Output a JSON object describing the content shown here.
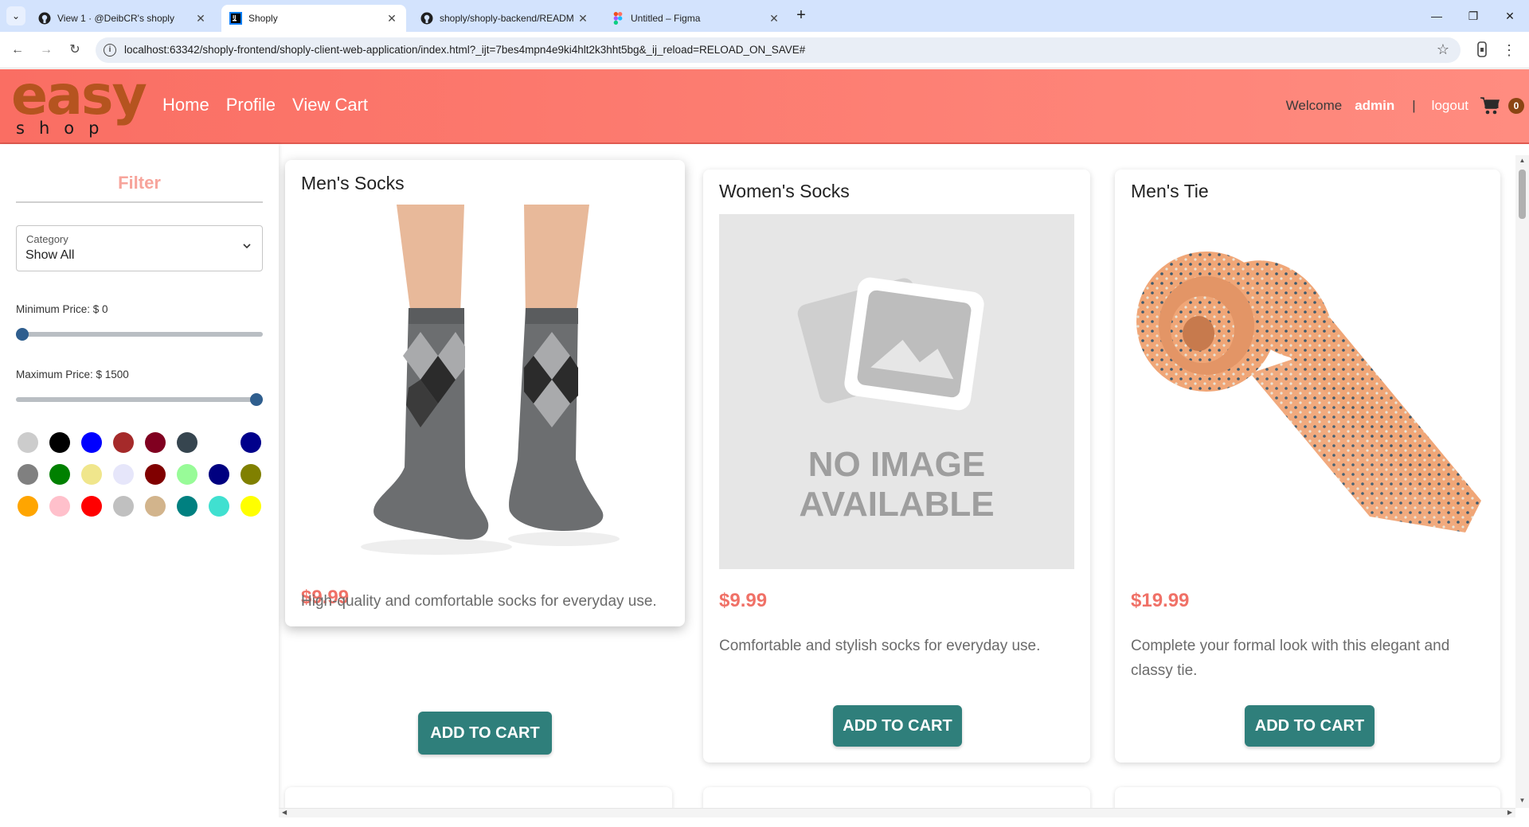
{
  "browser": {
    "tabs": [
      {
        "title": "View 1 · @DeibCR's shoply",
        "icon": "github-icon",
        "active": false
      },
      {
        "title": "Shoply",
        "icon": "intellij-icon",
        "active": true
      },
      {
        "title": "shoply/shoply-backend/READM",
        "icon": "github-icon",
        "active": false
      },
      {
        "title": "Untitled – Figma",
        "icon": "figma-icon",
        "active": false
      }
    ],
    "url": "localhost:63342/shoply-frontend/shoply-client-web-application/index.html?_ijt=7bes4mpn4e9ki4hlt2k3hht5bg&_ij_reload=RELOAD_ON_SAVE#"
  },
  "header": {
    "logo_main": "easy",
    "logo_sub": "shop",
    "nav": [
      "Home",
      "Profile",
      "View Cart"
    ],
    "welcome": "Welcome",
    "username": "admin",
    "separator": "|",
    "logout": "logout",
    "cart_count": "0",
    "brand_color": "#fa6e63"
  },
  "filter": {
    "title": "Filter",
    "category_label": "Category",
    "category_value": "Show All",
    "min_price_label": "Minimum Price: $ 0",
    "max_price_label": "Maximum Price: $ 1500",
    "min_price_fraction": 0.0,
    "max_price_fraction": 1.0,
    "colors": [
      "#cccccc",
      "#000000",
      "#0000ff",
      "#a52a2a",
      "#800020",
      "#36454f",
      "#ffffff",
      "#00008b",
      "#808080",
      "#008000",
      "#f0e68c",
      "#e6e6fa",
      "#800000",
      "#98fb98",
      "#000080",
      "#808000",
      "#ffa500",
      "#ffc0cb",
      "#ff0000",
      "#c0c0c0",
      "#d2b48c",
      "#008080",
      "#40e0d0",
      "#ffff00"
    ]
  },
  "products": [
    {
      "name": "Men's Socks",
      "price": "$9.99",
      "description": "High-quality and comfortable socks for everyday use.",
      "button": "ADD TO CART",
      "image": "socks-photo"
    },
    {
      "name": "Women's Socks",
      "price": "$9.99",
      "description": "Comfortable and stylish socks for everyday use.",
      "button": "ADD TO CART",
      "image": "no-image-placeholder",
      "placeholder_text_1": "NO IMAGE",
      "placeholder_text_2": "AVAILABLE"
    },
    {
      "name": "Men's Tie",
      "price": "$19.99",
      "description": "Complete your formal look with this elegant and classy tie.",
      "button": "ADD TO CART",
      "image": "tie-photo"
    }
  ],
  "accent_button_color": "#2f7f7b",
  "price_color": "#f07167"
}
